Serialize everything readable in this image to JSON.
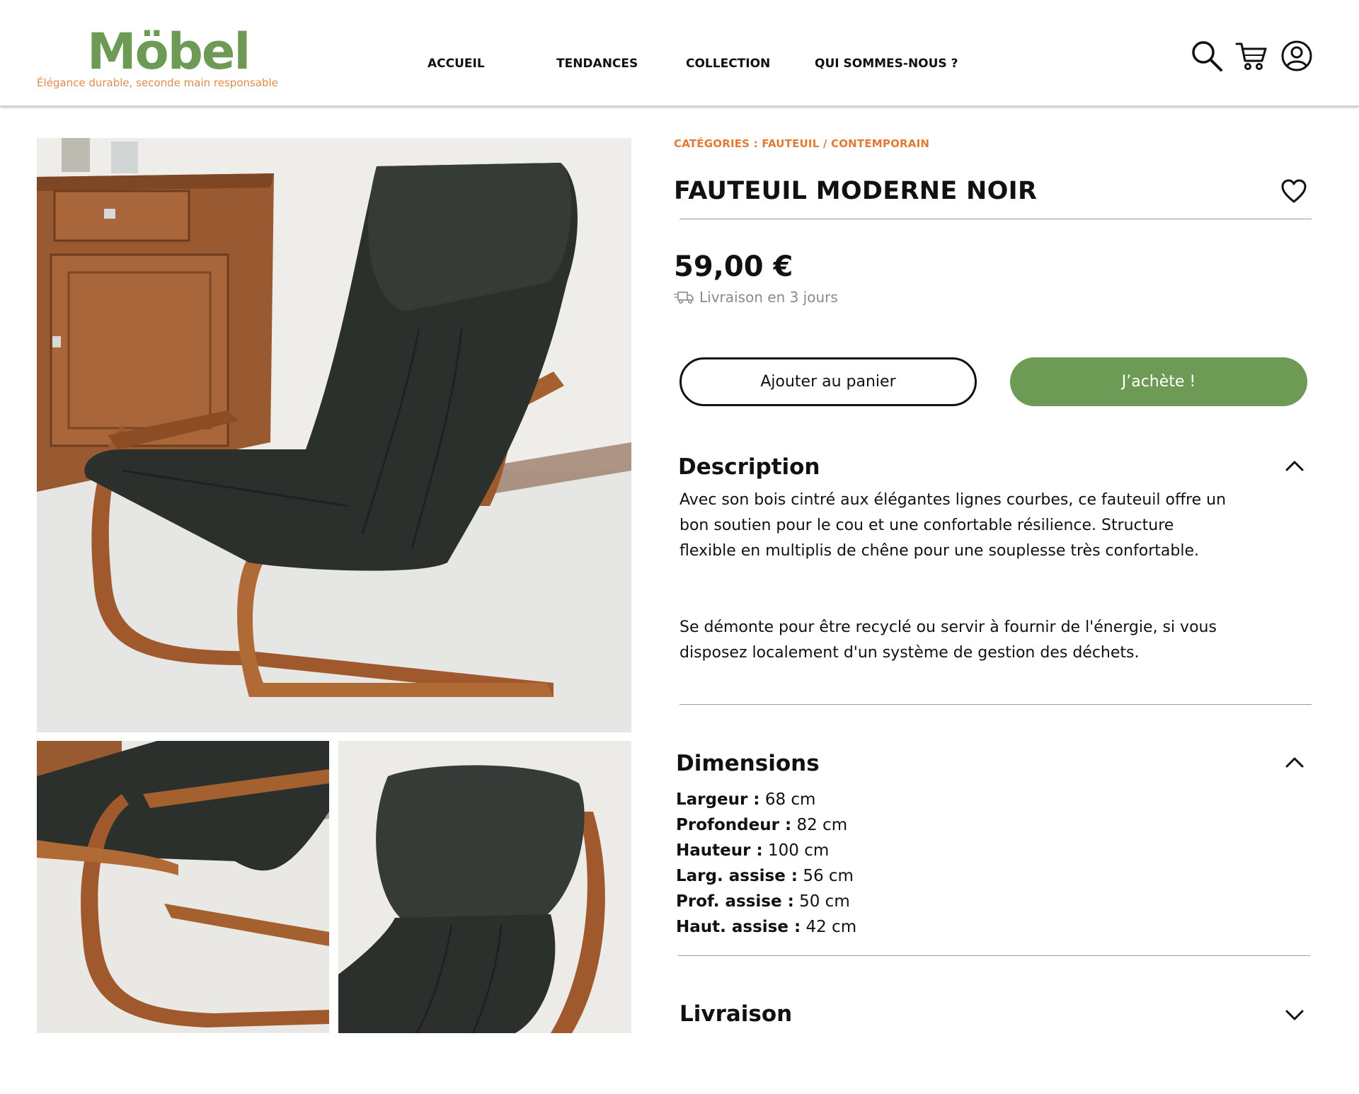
{
  "brand": {
    "logo": "Möbel",
    "tagline": "Élégance durable, seconde main responsable"
  },
  "nav": {
    "items": [
      "ACCUEIL",
      "TENDANCES",
      "COLLECTION",
      "QUI SOMMES-NOUS ?"
    ]
  },
  "header_icons": [
    "search-icon",
    "cart-icon",
    "account-icon"
  ],
  "product": {
    "categories": "CATÉGORIES : FAUTEUIL / CONTEMPORAIN",
    "title": "FAUTEUIL MODERNE NOIR",
    "price": "59,00 €",
    "delivery": "Livraison en 3 jours",
    "add_to_cart": "Ajouter au panier",
    "buy_now": "J’achète !"
  },
  "sections": {
    "description": {
      "title": "Description",
      "paragraphs": [
        "Avec son bois cintré aux élégantes lignes courbes, ce fauteuil offre un bon soutien pour le cou et une confortable résilience. Structure flexible en multiplis de chêne pour une souplesse très confortable.",
        "Se démonte pour être recyclé ou servir à fournir de l'énergie, si vous disposez localement d'un système de gestion des déchets."
      ]
    },
    "dimensions": {
      "title": "Dimensions",
      "rows": [
        {
          "label": "Largeur :",
          "value": " 68 cm"
        },
        {
          "label": "Profondeur :",
          "value": " 82 cm"
        },
        {
          "label": "Hauteur :",
          "value": " 100 cm"
        },
        {
          "label": "Larg. assise :",
          "value": " 56 cm"
        },
        {
          "label": "Prof. assise :",
          "value": " 50 cm"
        },
        {
          "label": "Haut. assise :",
          "value": " 42 cm"
        }
      ]
    },
    "livraison": {
      "title": "Livraison"
    }
  },
  "colors": {
    "brand_green": "#6d9a55",
    "accent_orange": "#e07a35",
    "tagline_orange": "#e08a4c",
    "text": "#111111",
    "muted": "#8a8a8a"
  }
}
